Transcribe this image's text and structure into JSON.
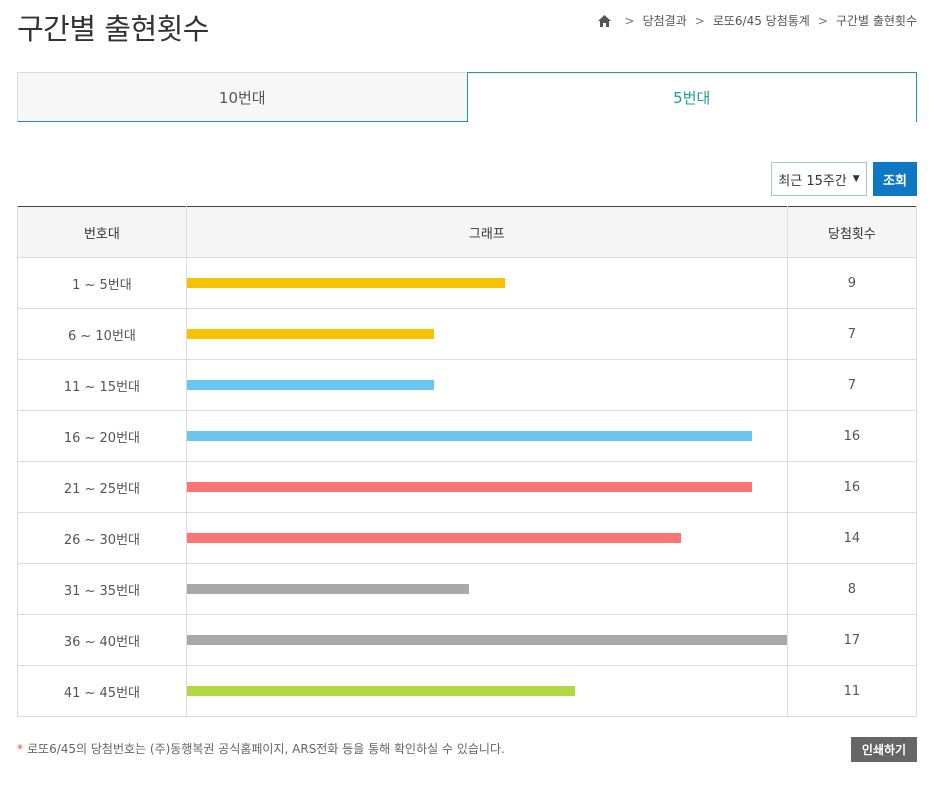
{
  "page": {
    "title": "구간별 출현횟수"
  },
  "breadcrumb": {
    "items": [
      "당첨결과",
      "로또6/45 당첨통계",
      "구간별 출현횟수"
    ]
  },
  "tabs": [
    {
      "label": "10번대",
      "active": false
    },
    {
      "label": "5번대",
      "active": true
    }
  ],
  "controls": {
    "period": "최근 15주간",
    "query_label": "조회"
  },
  "table": {
    "headers": [
      "번호대",
      "그래프",
      "당첨횟수"
    ],
    "max_count": 17,
    "rows": [
      {
        "range": "1 ~ 5번대",
        "count": 9,
        "color": "#f7c300"
      },
      {
        "range": "6 ~ 10번대",
        "count": 7,
        "color": "#f7c300"
      },
      {
        "range": "11 ~ 15번대",
        "count": 7,
        "color": "#6ac6ef"
      },
      {
        "range": "16 ~ 20번대",
        "count": 16,
        "color": "#6ac6ef"
      },
      {
        "range": "21 ~ 25번대",
        "count": 16,
        "color": "#fb7575"
      },
      {
        "range": "26 ~ 30번대",
        "count": 14,
        "color": "#fb7575"
      },
      {
        "range": "31 ~ 35번대",
        "count": 8,
        "color": "#a9a9a9"
      },
      {
        "range": "36 ~ 40번대",
        "count": 17,
        "color": "#a9a9a9"
      },
      {
        "range": "41 ~ 45번대",
        "count": 11,
        "color": "#b0d840"
      }
    ]
  },
  "footer": {
    "note": "로또6/45의 당첨번호는 (주)동행복권 공식홈페이지, ARS전화 등을 통해 확인하실 수 있습니다.",
    "print_label": "인쇄하기"
  }
}
